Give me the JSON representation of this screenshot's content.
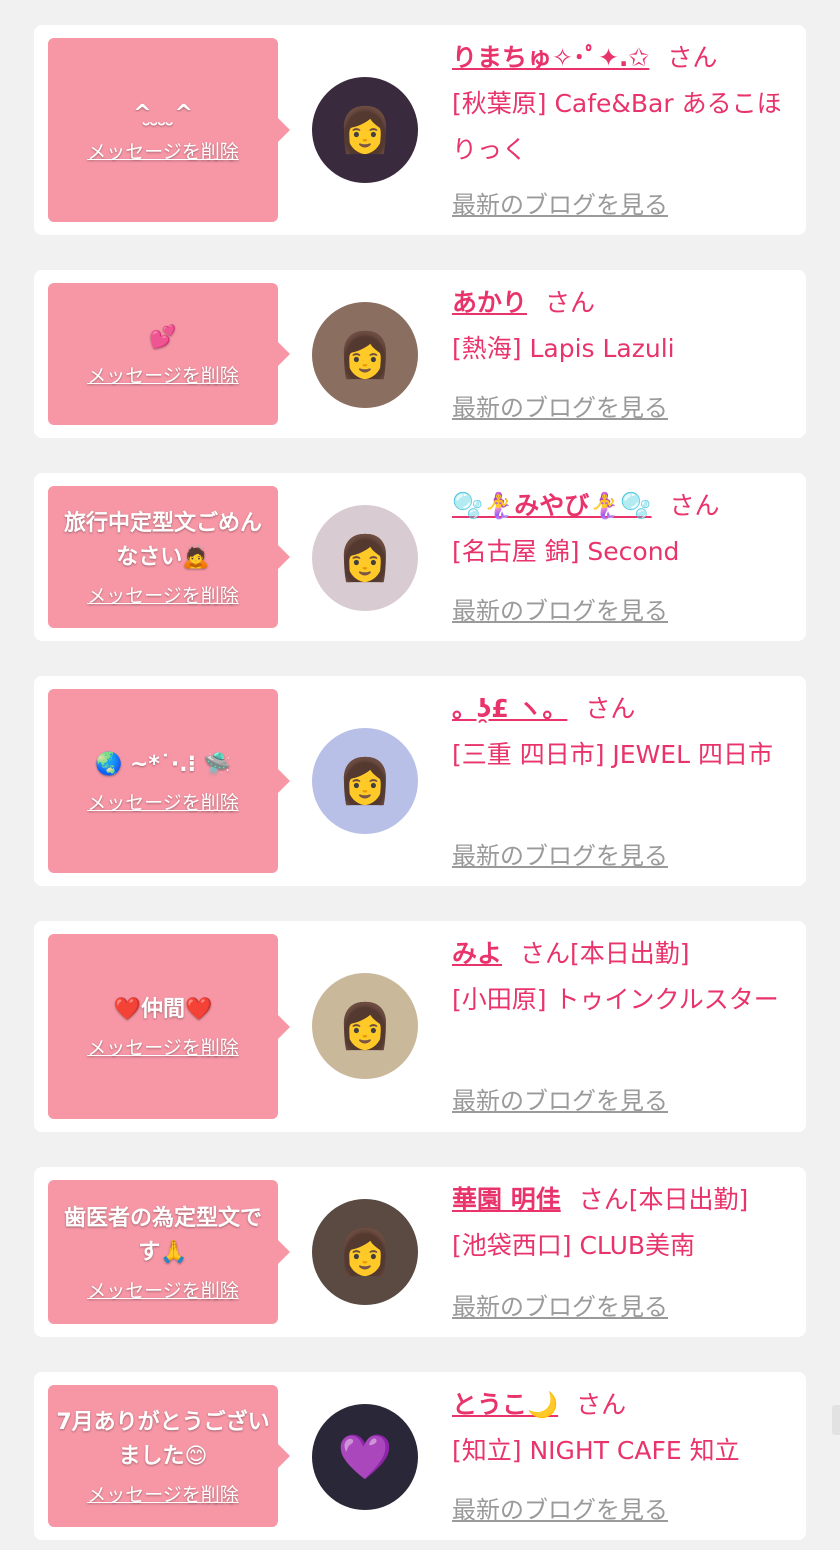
{
  "colors": {
    "background": "#f1f1f1",
    "card": "#ffffff",
    "bubble": "#f797a6",
    "accent": "#e8336b",
    "muted": "#9a9a9a"
  },
  "delete_label": "メッセージを削除",
  "blog_label": "最新のブログを見る",
  "san_label": "さん",
  "items": [
    {
      "message": "^̮ ̮ ̮ ̮^",
      "name": "りまちゅ✧･ﾟ✦.✩",
      "status": "",
      "shop": "[秋葉原] Cafe&Bar あるこほりっく",
      "avatar_icon": "portrait-photo",
      "avatar_color": "#3a2a3e"
    },
    {
      "message": "💕",
      "name": "あかり",
      "status": "",
      "shop": "[熱海] Lapis Lazuli",
      "avatar_icon": "portrait-photo",
      "avatar_color": "#8a6e60"
    },
    {
      "message": "旅行中定型文ごめんなさい🙇",
      "name": "🫧🧜‍♀️みやび🧜‍♀️🫧",
      "status": "",
      "shop": "[名古屋 錦] Second",
      "avatar_icon": "portrait-photo",
      "avatar_color": "#d8cbd2"
    },
    {
      "message": "🌏 ~*˙·.⁝ 🛸",
      "name": "。ʖ̯£ ヽ。",
      "status": "",
      "shop": "[三重 四日市] JEWEL 四日市",
      "avatar_icon": "portrait-photo",
      "avatar_color": "#b8c0e8"
    },
    {
      "message": "❤️仲間❤️",
      "name": "みよ",
      "status": "[本日出勤]",
      "shop": "[小田原] トゥインクルスター",
      "avatar_icon": "portrait-photo",
      "avatar_color": "#c9b89a"
    },
    {
      "message": "歯医者の為定型文です🙏",
      "name": "華園 明佳",
      "status": "[本日出勤]",
      "shop": "[池袋西口] CLUB美南",
      "avatar_icon": "portrait-photo",
      "avatar_color": "#5a4a42"
    },
    {
      "message": "7月ありがとうございました😊",
      "name": "とうこ🌙",
      "status": "",
      "shop": "[知立] NIGHT CAFE 知立",
      "avatar_icon": "heart-portrait-photo",
      "avatar_color": "#2a2838"
    }
  ]
}
